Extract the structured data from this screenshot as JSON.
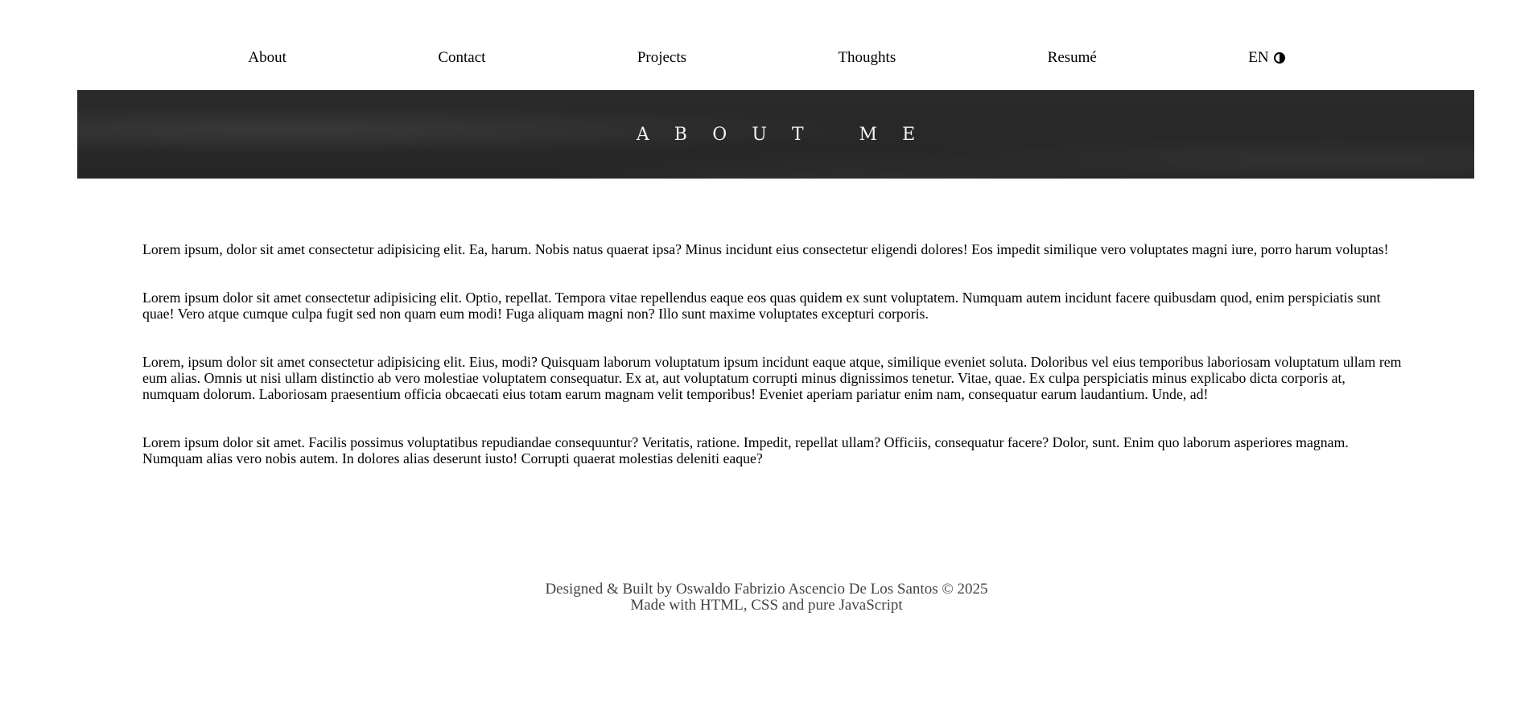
{
  "nav": {
    "items": [
      {
        "label": "About"
      },
      {
        "label": "Contact"
      },
      {
        "label": "Projects"
      },
      {
        "label": "Thoughts"
      },
      {
        "label": "Resumé"
      }
    ],
    "language": "EN",
    "theme_icon": "half-circle-contrast-icon"
  },
  "banner": {
    "title": "ABOUT ME"
  },
  "content": {
    "paragraphs": [
      "Lorem ipsum, dolor sit amet consectetur adipisicing elit. Ea, harum. Nobis natus quaerat ipsa? Minus incidunt eius consectetur eligendi dolores! Eos impedit similique vero voluptates magni iure, porro harum voluptas!",
      "Lorem ipsum dolor sit amet consectetur adipisicing elit. Optio, repellat. Tempora vitae repellendus eaque eos quas quidem ex sunt voluptatem. Numquam autem incidunt facere quibusdam quod, enim perspiciatis sunt quae! Vero atque cumque culpa fugit sed non quam eum modi! Fuga aliquam magni non? Illo sunt maxime voluptates excepturi corporis.",
      "Lorem, ipsum dolor sit amet consectetur adipisicing elit. Eius, modi? Quisquam laborum voluptatum ipsum incidunt eaque atque, similique eveniet soluta. Doloribus vel eius temporibus laboriosam voluptatum ullam rem eum alias. Omnis ut nisi ullam distinctio ab vero molestiae voluptatem consequatur. Ex at, aut voluptatum corrupti minus dignissimos tenetur. Vitae, quae. Ex culpa perspiciatis minus explicabo dicta corporis at, numquam dolorum. Laboriosam praesentium officia obcaecati eius totam earum magnam velit temporibus! Eveniet aperiam pariatur enim nam, consequatur earum laudantium. Unde, ad!",
      "Lorem ipsum dolor sit amet. Facilis possimus voluptatibus repudiandae consequuntur? Veritatis, ratione. Impedit, repellat ullam? Officiis, consequatur facere? Dolor, sunt. Enim quo laborum asperiores magnam. Numquam alias vero nobis autem. In dolores alias deserunt iusto! Corrupti quaerat molestias deleniti eaque?"
    ]
  },
  "footer": {
    "line1": "Designed & Built by Oswaldo Fabrizio Ascencio De Los Santos © 2025",
    "line2": "Made with HTML, CSS and pure JavaScript"
  },
  "colors": {
    "banner_bg": "#262626",
    "banner_text": "#f2f2f2",
    "footer_text": "#444444"
  }
}
